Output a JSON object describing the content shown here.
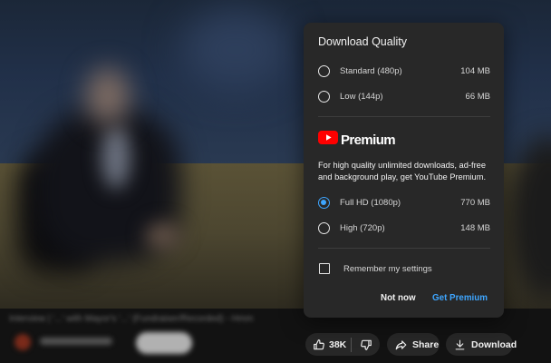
{
  "caption_blurred": "Interview | '...' with Mayor's '...' (Fundraiser/Recorded) - Hmm",
  "dialog": {
    "title": "Download Quality",
    "standard_options": [
      {
        "label": "Standard (480p)",
        "size": "104 MB",
        "selected": false
      },
      {
        "label": "Low (144p)",
        "size": "66 MB",
        "selected": false
      }
    ],
    "premium": {
      "logo_text": "Premium",
      "description": "For high quality unlimited downloads, ad-free and background play, get YouTube Premium.",
      "options": [
        {
          "label": "Full HD (1080p)",
          "size": "770 MB",
          "selected": true
        },
        {
          "label": "High (720p)",
          "size": "148 MB",
          "selected": false
        }
      ]
    },
    "remember_label": "Remember my settings",
    "remember_checked": false,
    "not_now_label": "Not now",
    "get_premium_label": "Get Premium"
  },
  "actions": {
    "like_count": "38K",
    "share_label": "Share",
    "download_label": "Download"
  },
  "colors": {
    "accent": "#3ea6ff",
    "dialog_bg": "#282828",
    "youtube_red": "#ff0000"
  }
}
